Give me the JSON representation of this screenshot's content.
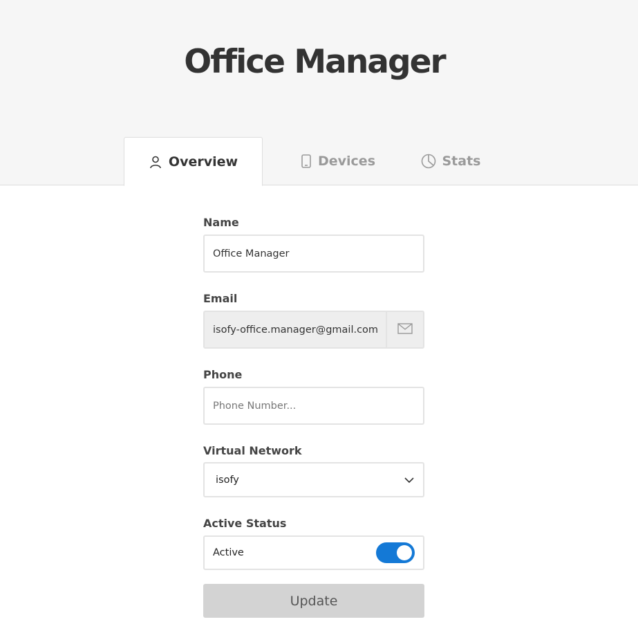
{
  "header": {
    "title": "Office Manager"
  },
  "tabs": [
    {
      "label": "Overview",
      "icon": "user-icon",
      "active": true
    },
    {
      "label": "Devices",
      "icon": "phone-icon",
      "active": false
    },
    {
      "label": "Stats",
      "icon": "pie-chart-icon",
      "active": false
    }
  ],
  "form": {
    "name": {
      "label": "Name",
      "value": "Office Manager",
      "placeholder": ""
    },
    "email": {
      "label": "Email",
      "value": "isofy-office.manager@gmail.com",
      "icon": "envelope-icon"
    },
    "phone": {
      "label": "Phone",
      "value": "",
      "placeholder": "Phone Number..."
    },
    "network": {
      "label": "Virtual Network",
      "value": "isofy",
      "icon": "chevron-down-icon"
    },
    "status": {
      "label": "Active Status",
      "value": "Active",
      "enabled": true
    },
    "update_label": "Update"
  },
  "colors": {
    "accent": "#1479d6",
    "header_bg": "#f6f6f6",
    "button_disabled": "#d3d3d3"
  }
}
